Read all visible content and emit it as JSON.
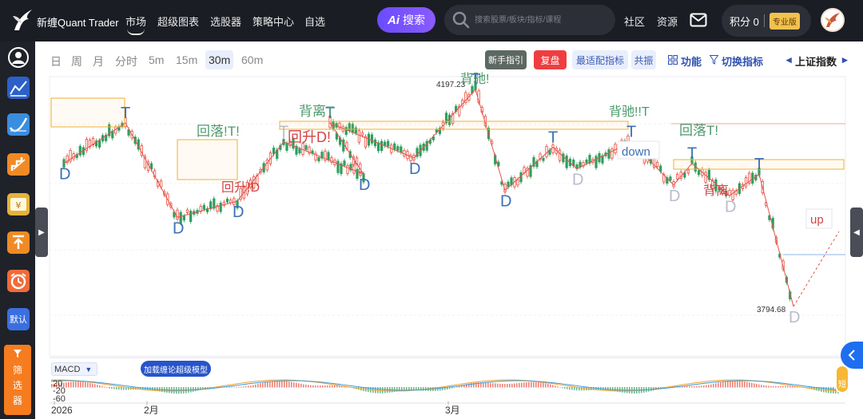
{
  "header": {
    "brand": "新缠Quant Trader",
    "nav": [
      "市场",
      "超级图表",
      "选股器",
      "策略中心",
      "自选"
    ],
    "ai_label": "搜索",
    "search_placeholder": "搜索股票/板块/指标/课程",
    "community": "社区",
    "resources": "资源",
    "points": "积分 0",
    "pro": "专业版"
  },
  "sidebar": {
    "default_label": "默认",
    "filter_label": [
      "筛",
      "选",
      "器"
    ]
  },
  "toolbar": {
    "periods": [
      "日",
      "周",
      "月",
      "分时",
      "5m",
      "15m",
      "30m",
      "60m"
    ],
    "active_period": "30m",
    "guide": "新手指引",
    "replay": "复盘",
    "best_indicator": "最适配指标",
    "resonance": "共振",
    "function": "功能",
    "switch_indicator": "切换指标",
    "index_name": "上证指数"
  },
  "colors": {
    "up": "#e74c3c",
    "down": "#2e9e5e",
    "top_label": "#3b6fb8",
    "annot_green": "#4e9a6e",
    "annot_red": "#d44545",
    "box": "#f0b030"
  },
  "chart_data": {
    "type": "candlestick",
    "price_high_label": "4197.23",
    "price_low_label": "3794.68",
    "pivots": [
      {
        "label": "D",
        "price": 4060
      },
      {
        "label": "T",
        "price": 4135
      },
      {
        "label": "D",
        "price": 3960
      },
      {
        "label": "D",
        "price": 3990
      },
      {
        "label": "T",
        "price": 4100
      },
      {
        "label": "D",
        "price": 4040
      },
      {
        "label": "T",
        "price": 4135
      },
      {
        "label": "D",
        "price": 4070
      },
      {
        "label": "T",
        "price": 4197.23
      },
      {
        "label": "D",
        "price": 4010
      },
      {
        "label": "T",
        "price": 4090
      },
      {
        "label": "D",
        "price": 4050
      },
      {
        "label": "T",
        "price": 4100
      },
      {
        "label": "D",
        "price": 4020
      },
      {
        "label": "T",
        "price": 4060
      },
      {
        "label": "D",
        "price": 4000
      },
      {
        "label": "T",
        "price": 4040
      },
      {
        "label": "D",
        "price": 3794.68
      }
    ],
    "annotations": {
      "fall_back": "回落!T!",
      "divergence": "背离T",
      "rise_back": "回升!D",
      "rise_back2": "回升D!",
      "diverge_stall": "背驰!!T",
      "diverge_top": "背驰!",
      "fall_back2": "回落T!",
      "divergence2": "背离",
      "down": "down",
      "up": "up"
    },
    "x_labels": [
      "2026",
      "2月",
      "3月"
    ],
    "macd": {
      "name": "MACD",
      "y_ticks": [
        "20",
        "-20",
        "-60"
      ]
    },
    "load_model": "加载缠论超级模型",
    "short_label": "短"
  }
}
